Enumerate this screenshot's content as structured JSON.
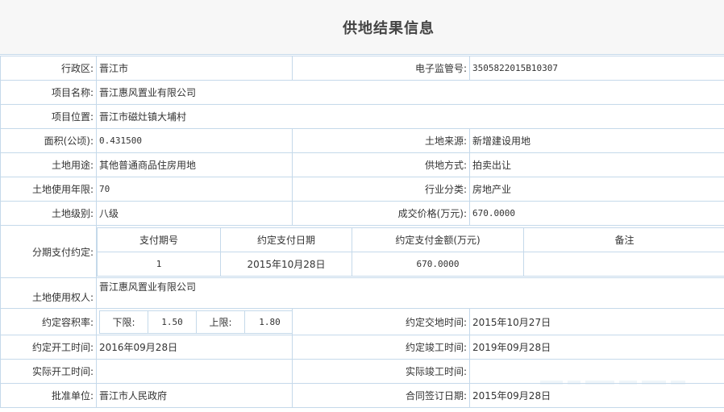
{
  "title": "供地结果信息",
  "fields": {
    "admin_region": {
      "label": "行政区:",
      "value": "晋江市"
    },
    "supervision_no": {
      "label": "电子监管号:",
      "value": "3505822015B10307"
    },
    "project_name": {
      "label": "项目名称:",
      "value": "晋江惠风置业有限公司"
    },
    "project_location": {
      "label": "项目位置:",
      "value": "晋江市磁灶镇大埔村"
    },
    "area": {
      "label": "面积(公顷):",
      "value": "0.431500"
    },
    "land_source": {
      "label": "土地来源:",
      "value": "新增建设用地"
    },
    "land_use": {
      "label": "土地用途:",
      "value": "其他普通商品住房用地"
    },
    "supply_method": {
      "label": "供地方式:",
      "value": "拍卖出让"
    },
    "use_years": {
      "label": "土地使用年限:",
      "value": "70"
    },
    "industry": {
      "label": "行业分类:",
      "value": "房地产业"
    },
    "land_grade": {
      "label": "土地级别:",
      "value": "八级"
    },
    "price": {
      "label": "成交价格(万元):",
      "value": "670.0000"
    },
    "installment": {
      "label": "分期支付约定:",
      "headers": [
        "支付期号",
        "约定支付日期",
        "约定支付金额(万元)",
        "备注"
      ],
      "rows": [
        [
          "1",
          "2015年10月28日",
          "670.0000",
          ""
        ]
      ]
    },
    "land_user": {
      "label": "土地使用权人:",
      "value": "晋江惠风置业有限公司"
    },
    "far": {
      "label": "约定容积率:",
      "lower_label": "下限:",
      "lower_value": "1.50",
      "upper_label": "上限:",
      "upper_value": "1.80"
    },
    "handover_date": {
      "label": "约定交地时间:",
      "value": "2015年10月27日"
    },
    "start_date": {
      "label": "约定开工时间:",
      "value": "2016年09月28日"
    },
    "completion_date": {
      "label": "约定竣工时间:",
      "value": "2019年09月28日"
    },
    "actual_start": {
      "label": "实际开工时间:",
      "value": ""
    },
    "actual_completion": {
      "label": "实际竣工时间:",
      "value": ""
    },
    "approval_unit": {
      "label": "批准单位:",
      "value": "晋江市人民政府"
    },
    "contract_date": {
      "label": "合同签订日期:",
      "value": "2015年09月28日"
    }
  }
}
